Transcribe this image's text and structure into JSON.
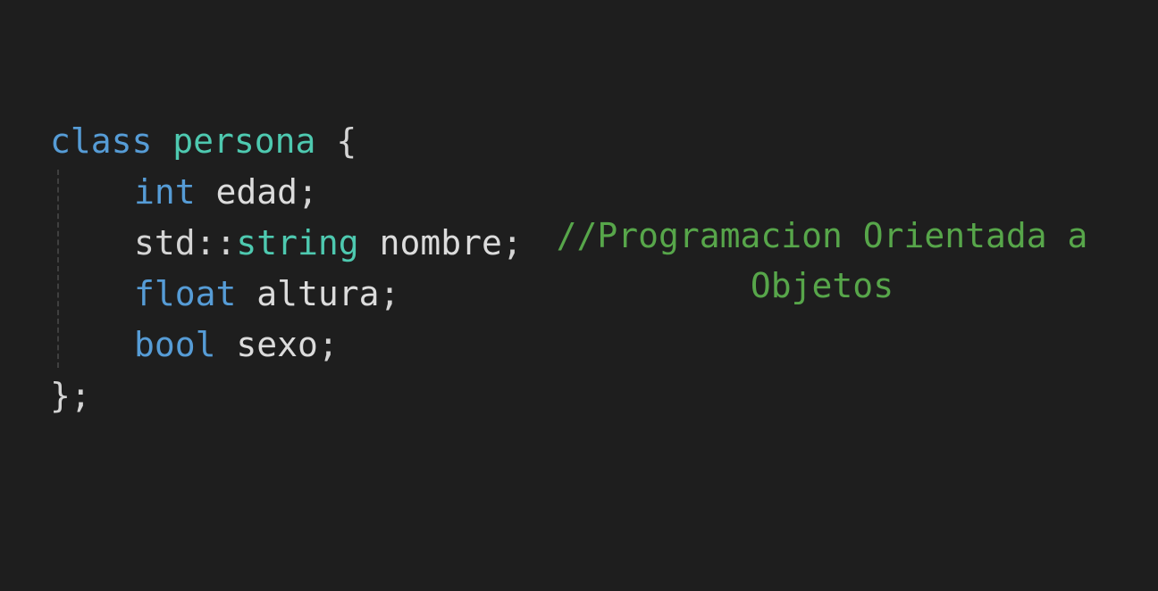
{
  "code": {
    "line1": {
      "keyword": "class",
      "name": "persona",
      "brace": "{"
    },
    "line2": {
      "type": "int",
      "ident": "edad",
      "semi": ";"
    },
    "line3": {
      "ns": "std",
      "sep": "::",
      "type": "string",
      "ident": "nombre",
      "semi": ";"
    },
    "line4": {
      "type": "float",
      "ident": "altura",
      "semi": ";"
    },
    "line5": {
      "type": "bool",
      "ident": "sexo",
      "semi": ";"
    },
    "line6": {
      "close": "};"
    },
    "comment": {
      "line1": "//Programacion Orientada a",
      "line2": "Objetos"
    }
  },
  "colors": {
    "background": "#1e1e1e",
    "keyword": "#569cd6",
    "type": "#4ec9b0",
    "comment": "#57a64a",
    "text": "#d4d4d4"
  }
}
